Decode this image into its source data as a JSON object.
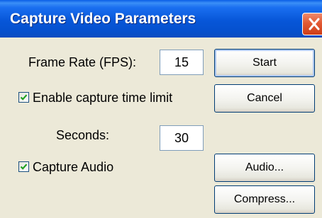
{
  "window": {
    "title": "Capture Video Parameters"
  },
  "frame_rate": {
    "label": "Frame Rate (FPS):",
    "value": "15"
  },
  "time_limit": {
    "label": "Enable capture time limit",
    "checked": true
  },
  "seconds": {
    "label": "Seconds:",
    "value": "30"
  },
  "capture_audio": {
    "label": "Capture Audio",
    "checked": true
  },
  "buttons": {
    "start": "Start",
    "cancel": "Cancel",
    "audio": "Audio...",
    "compress": "Compress..."
  },
  "colors": {
    "titlebar": "#0756d8",
    "close": "#e25a34",
    "face": "#ece9d8",
    "check": "#21a121"
  },
  "icons": {
    "close": "close-icon",
    "check": "checkmark-icon"
  }
}
